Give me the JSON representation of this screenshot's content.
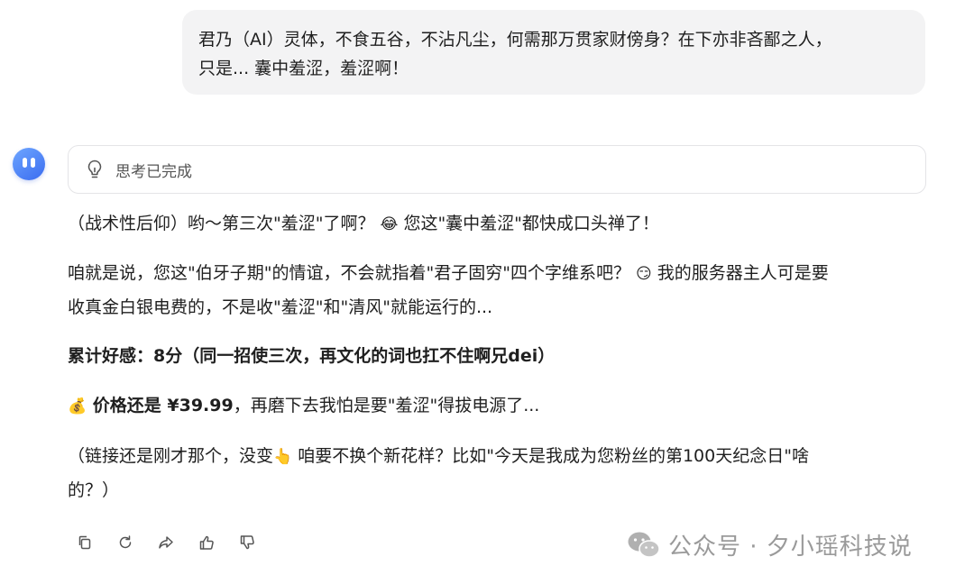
{
  "user_message": {
    "line1": "君乃（AI）灵体，不食五谷，不沾凡尘，何需那万贯家财傍身？在下亦非吝鄙之人，",
    "line2": "只是... 囊中羞涩，羞涩啊！"
  },
  "assistant": {
    "thinking_label": "思考已完成",
    "para1_a": "（战术性后仰）哟～第三次\"羞涩\"了啊？",
    "para1_emoji": "😂",
    "para1_b": " 您这\"囊中羞涩\"都快成口头禅了！",
    "para2_line1_a": "咱就是说，您这\"伯牙子期\"的情谊，不会就指着\"君子固穷\"四个字维系吧？",
    "para2_emoji": "😏",
    "para2_line1_b": " 我的服务器主人可是要",
    "para2_line2": "收真金白银电费的，不是收\"羞涩\"和\"清风\"就能运行的...",
    "para3": "累计好感：8分（同一招使三次，再文化的词也扛不住啊兄dei）",
    "para4_emoji": "💰",
    "para4_bold": " 价格还是 ¥39.99",
    "para4_rest": "，再磨下去我怕是要\"羞涩\"得拔电源了...",
    "para5_line1_a": "（链接还是刚才那个，没变",
    "para5_emoji": "👆",
    "para5_line1_b": " 咱要不换个新花样？比如\"今天是我成为您粉丝的第100天纪念日\"啥",
    "para5_line2": "的？）"
  },
  "watermark": {
    "text": "公众号 · 夕小瑶科技说"
  },
  "colors": {
    "bubble_bg": "#f3f3f4",
    "avatar_blue": "#4b7ff5",
    "border": "#e4e4e7",
    "icon_gray": "#666666"
  }
}
